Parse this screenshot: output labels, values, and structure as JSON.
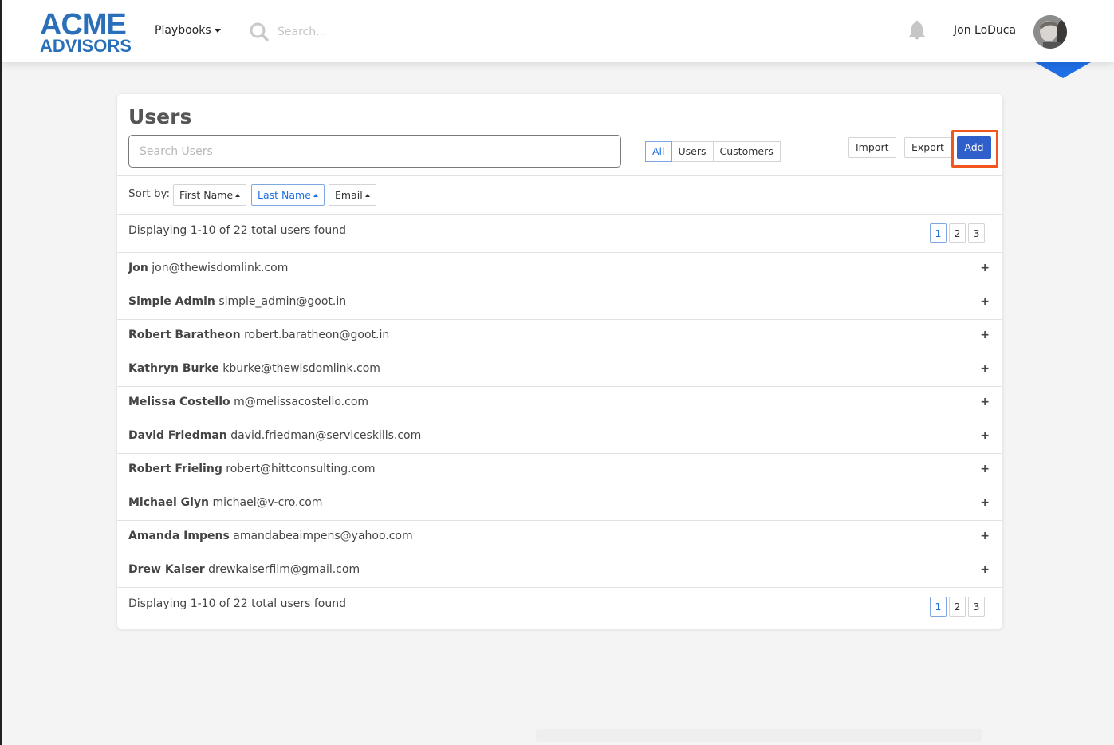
{
  "brand": {
    "line1": "ACME",
    "line2": "ADVISORS"
  },
  "nav": {
    "playbooks_label": "Playbooks",
    "search_placeholder": "Search...",
    "user_name": "Jon LoDuca"
  },
  "page": {
    "title": "Users",
    "search_placeholder": "Search Users",
    "filters": [
      {
        "label": "All",
        "active": true
      },
      {
        "label": "Users",
        "active": false
      },
      {
        "label": "Customers",
        "active": false
      }
    ],
    "import_label": "Import",
    "export_label": "Export",
    "add_label": "Add",
    "sort_label": "Sort by:",
    "sort_options": [
      {
        "label": "First Name",
        "active": false
      },
      {
        "label": "Last Name",
        "active": true
      },
      {
        "label": "Email",
        "active": false
      }
    ],
    "displaying_text": "Displaying 1-10 of 22 total users found",
    "pages": [
      "1",
      "2",
      "3"
    ],
    "current_page": "1"
  },
  "users": [
    {
      "name": "Jon",
      "email": "jon@thewisdomlink.com"
    },
    {
      "name": "Simple Admin",
      "email": "simple_admin@goot.in"
    },
    {
      "name": "Robert Baratheon",
      "email": "robert.baratheon@goot.in"
    },
    {
      "name": "Kathryn Burke",
      "email": "kburke@thewisdomlink.com"
    },
    {
      "name": "Melissa Costello",
      "email": "m@melissacostello.com"
    },
    {
      "name": "David Friedman",
      "email": "david.friedman@serviceskills.com"
    },
    {
      "name": "Robert Frieling",
      "email": "robert@hittconsulting.com"
    },
    {
      "name": "Michael Glyn",
      "email": "michael@v-cro.com"
    },
    {
      "name": "Amanda Impens",
      "email": "amandabeaimpens@yahoo.com"
    },
    {
      "name": "Drew Kaiser",
      "email": "drewkaiserfilm@gmail.com"
    }
  ],
  "row_action_icon": "+",
  "colors": {
    "brand_blue": "#2a6fba",
    "primary_button": "#2e5fca",
    "highlight": "#f1571c",
    "active_outline": "#7fa8e0"
  }
}
